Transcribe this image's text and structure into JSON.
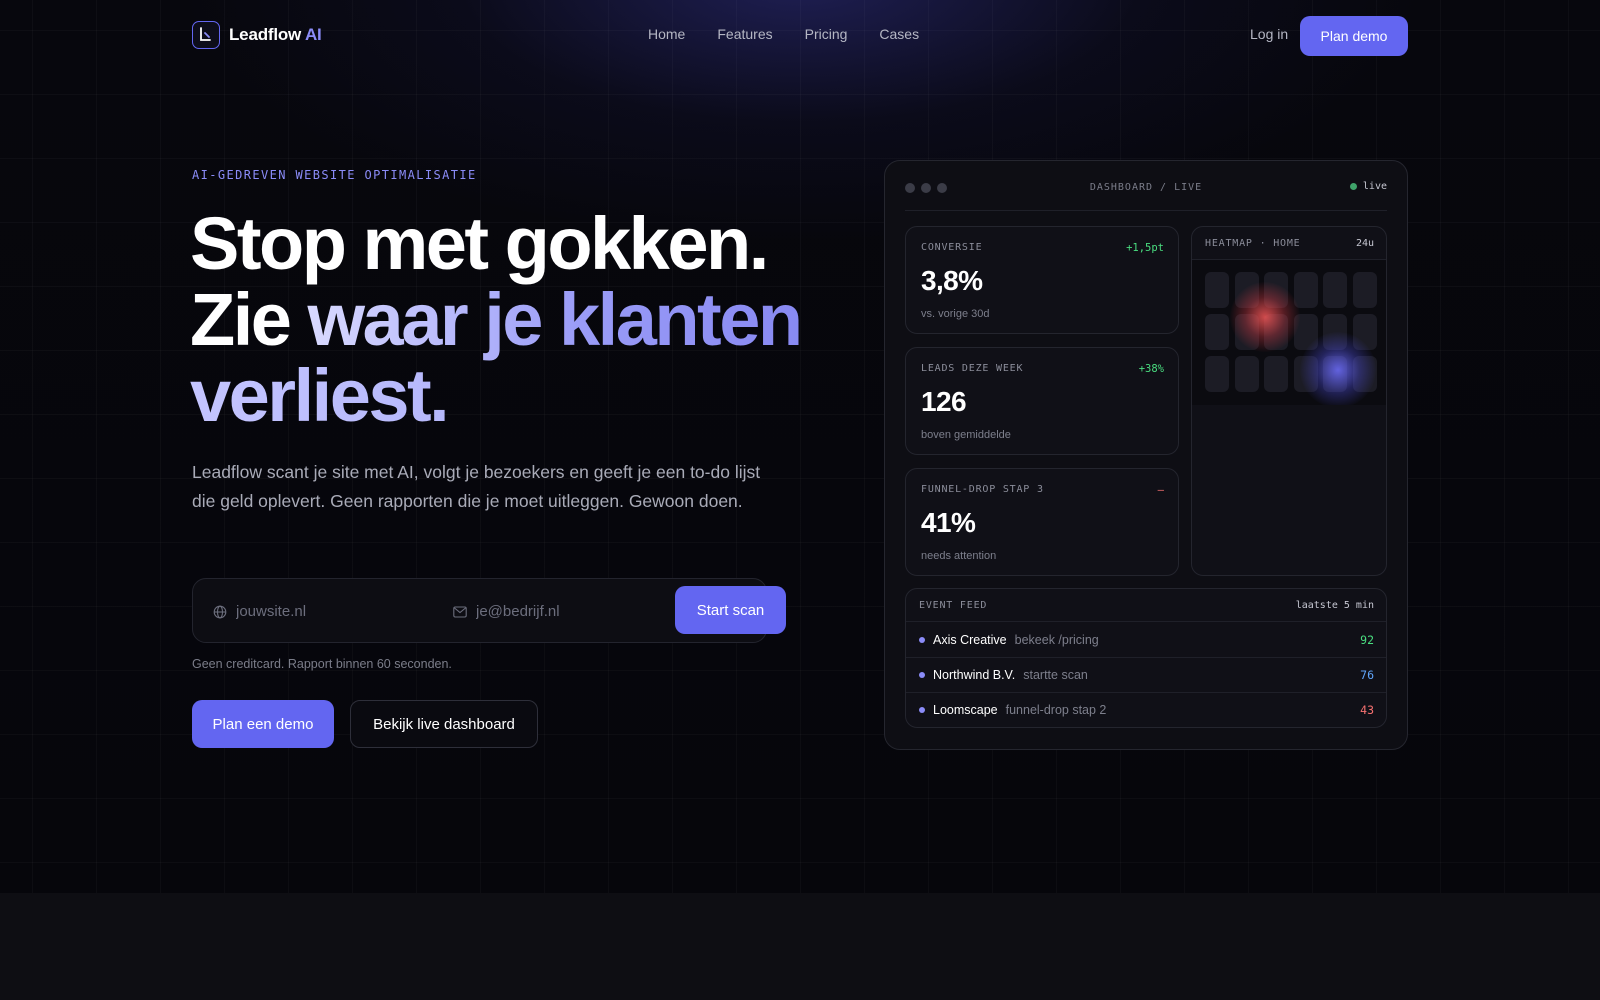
{
  "brand": {
    "name": "Leadflow",
    "suffix": "AI"
  },
  "nav": {
    "items": [
      {
        "label": "Home"
      },
      {
        "label": "Features"
      },
      {
        "label": "Pricing"
      },
      {
        "label": "Cases"
      }
    ],
    "login_label": "Log in",
    "demo_label": "Plan demo"
  },
  "hero": {
    "eyebrow": "AI-GEDREVEN WEBSITE OPTIMALISATIE",
    "headline_line1": "Stop met gokken.",
    "headline_zie": "Zie ",
    "headline_grad": "waar je klanten",
    "headline_line3": "verliest.",
    "lead": "Leadflow scant je site met AI, volgt je bezoekers en geeft je een to-do lijst die geld oplevert. Geen rapporten die je moet uitleggen. Gewoon doen.",
    "site_placeholder": "jouwsite.nl",
    "email_placeholder": "je@bedrijf.nl",
    "scan_label": "Start scan",
    "note": "Geen creditcard. Rapport binnen 60 seconden.",
    "primary_cta": "Plan een demo",
    "secondary_cta": "Bekijk live dashboard"
  },
  "dashboard": {
    "title": "DASHBOARD / LIVE",
    "live_label": "live",
    "metrics": [
      {
        "label": "CONVERSIE",
        "delta": "+1,5pt",
        "delta_color": "#4ade80",
        "value": "3,8%",
        "sub": "vs. vorige 30d"
      },
      {
        "label": "LEADS DEZE WEEK",
        "delta": "+38%",
        "delta_color": "#4ade80",
        "value": "126",
        "sub": "boven gemiddelde"
      },
      {
        "label": "FUNNEL-DROP STAP 3",
        "delta": "–",
        "delta_color": "#f87171",
        "value": "41%",
        "sub": "needs attention"
      }
    ],
    "heatmap": {
      "title": "HEATMAP · HOME",
      "range": "24u"
    },
    "feed": {
      "title": "EVENT FEED",
      "range": "laatste 5 min",
      "rows": [
        {
          "company": "Axis Creative",
          "action": "bekeek /pricing",
          "score": "92",
          "score_color": "#4ade80"
        },
        {
          "company": "Northwind B.V.",
          "action": "startte scan",
          "score": "76",
          "score_color": "#60a5fa"
        },
        {
          "company": "Loomscape",
          "action": "funnel-drop stap 2",
          "score": "43",
          "score_color": "#f87171"
        }
      ]
    }
  },
  "colors": {
    "accent": "#6366f1",
    "accent_light": "#8b8cf8",
    "background": "#07070c"
  }
}
